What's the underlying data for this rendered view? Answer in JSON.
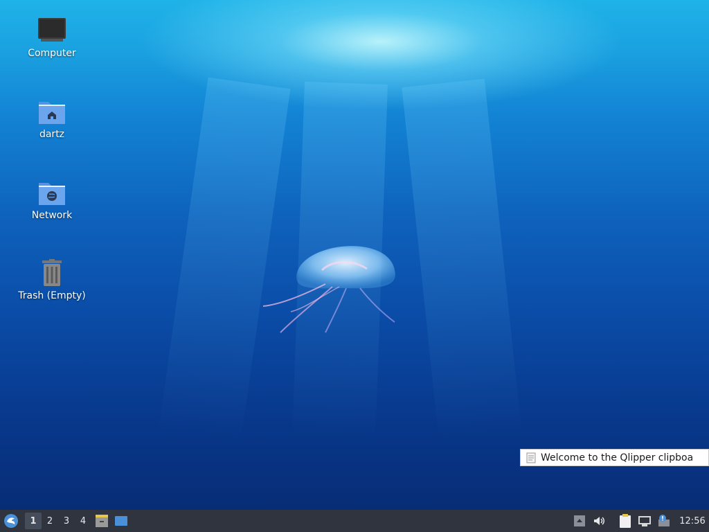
{
  "desktop": {
    "icons": [
      {
        "label": "Computer",
        "icon": "computer-icon"
      },
      {
        "label": "dartz",
        "icon": "home-folder-icon"
      },
      {
        "label": "Network",
        "icon": "network-folder-icon"
      },
      {
        "label": "Trash (Empty)",
        "icon": "trash-icon"
      }
    ],
    "wallpaper": "underwater-jellyfish"
  },
  "notification": {
    "text": "Welcome to the Qlipper clipboa",
    "icon": "note-icon"
  },
  "taskbar": {
    "start_icon": "start-menu-icon",
    "workspaces": [
      "1",
      "2",
      "3",
      "4"
    ],
    "active_workspace": "1",
    "quicklaunch": [
      "file-manager-icon",
      "show-desktop-icon"
    ],
    "tray": [
      "tray-expand-icon",
      "volume-icon",
      "clipboard-icon",
      "network-icon",
      "update-notifier-icon"
    ],
    "clock": "12:56",
    "colors": {
      "panel": "#2f343f",
      "accent": "#4a90d9"
    }
  }
}
